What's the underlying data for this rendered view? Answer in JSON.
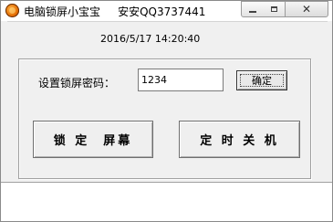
{
  "window": {
    "title": "电脑锁屏小宝宝     安安QQ3737441",
    "app_icon": "circular-orange-app-icon"
  },
  "window_controls": {
    "minimize_icon": "minimize-icon",
    "maximize_icon": "maximize-icon",
    "close_label": "✕"
  },
  "main": {
    "datetime": "2016/5/17 14:20:40",
    "password_label": "设置锁屏密码：",
    "password_value": "1234",
    "confirm_label": "确定",
    "lock_button_label": "锁 定  屏幕",
    "shutdown_button_label": "定 时 关 机"
  }
}
